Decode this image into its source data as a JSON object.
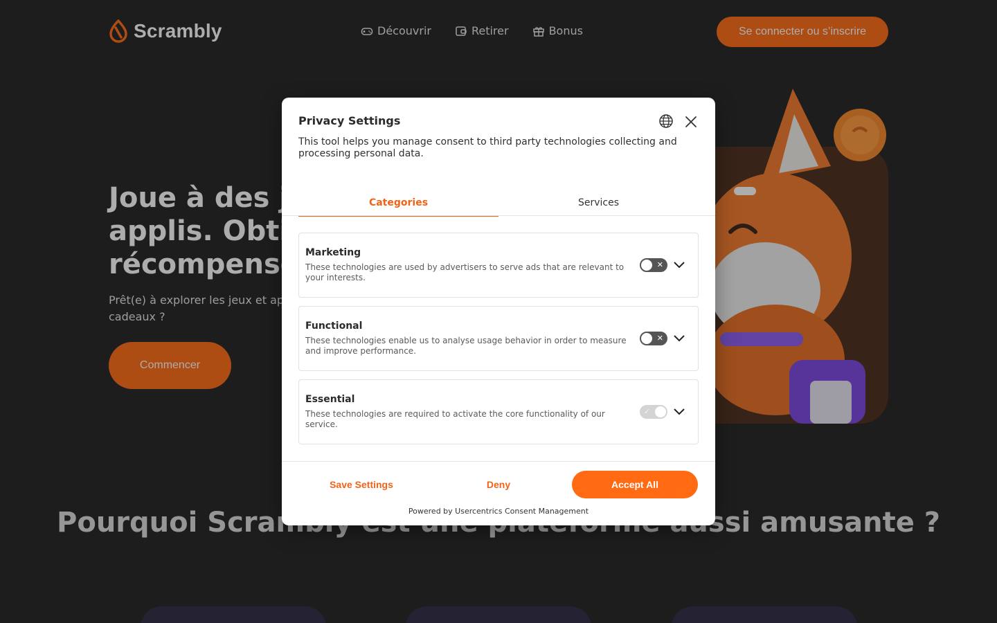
{
  "brand": {
    "name": "Scrambly",
    "accent": "#ff6a13"
  },
  "nav": {
    "items": [
      {
        "label": "Découvrir",
        "icon": "gamepad-icon"
      },
      {
        "label": "Retirer",
        "icon": "wallet-icon"
      },
      {
        "label": "Bonus",
        "icon": "gift-icon"
      }
    ],
    "login_label": "Se connecter ou s’inscrire"
  },
  "hero": {
    "title": "Joue à des jeux et essaie des applis. Obtiens des récompenses",
    "subtitle": "Prêt(e) à explorer les jeux et applis et à gagner des récompenses en cartes-cadeaux ?",
    "cta_label": "Commencer"
  },
  "section": {
    "title": "Pourquoi Scrambly est une plateforme aussi amusante ?"
  },
  "privacy": {
    "title": "Privacy Settings",
    "description": "This tool helps you manage consent to third party technologies collecting and processing personal data.",
    "tabs": [
      {
        "label": "Categories",
        "active": true
      },
      {
        "label": "Services",
        "active": false
      }
    ],
    "categories": [
      {
        "name": "Marketing",
        "description": "These technologies are used by advertisers to serve ads that are relevant to your interests.",
        "enabled": false,
        "locked": false
      },
      {
        "name": "Functional",
        "description": "These technologies enable us to analyse usage behavior in order to measure and improve performance.",
        "enabled": false,
        "locked": false
      },
      {
        "name": "Essential",
        "description": "These technologies are required to activate the core functionality of our service.",
        "enabled": true,
        "locked": true
      }
    ],
    "buttons": {
      "save": "Save Settings",
      "deny": "Deny",
      "accept": "Accept All"
    },
    "powered_by": "Powered by Usercentrics Consent Management"
  }
}
